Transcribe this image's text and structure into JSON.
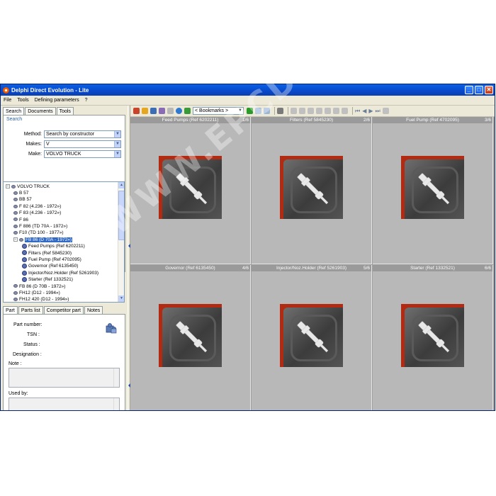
{
  "window": {
    "title": "Delphi Direct Evolution - Lite"
  },
  "menu": [
    "File",
    "Tools",
    "Defining parameters",
    "?"
  ],
  "left_tabs": [
    "Search",
    "Documents",
    "Tools"
  ],
  "search": {
    "heading": "Search",
    "method_label": "Method:",
    "method_value": "Search by constructor",
    "makes_label": "Makes:",
    "makes_value": "V",
    "make_label": "Make:",
    "make_value": "VOLVO TRUCK"
  },
  "tree": {
    "root": "VOLVO TRUCK",
    "items": [
      {
        "label": "B 57",
        "level": 1
      },
      {
        "label": "BB 57",
        "level": 1
      },
      {
        "label": "F 82 (4.236 - 1972»)",
        "level": 1
      },
      {
        "label": "F 83 (4.236 - 1972»)",
        "level": 1
      },
      {
        "label": "F 86",
        "level": 1
      },
      {
        "label": "F 886 (TD 70A - 1972»)",
        "level": 1
      },
      {
        "label": "F10 (TD 100 - 1977»)",
        "level": 1
      },
      {
        "label": "FB 86 (D 70A - 1972»)",
        "level": 1
      },
      {
        "label": "Feed Pumps (Ref 6202211)",
        "level": 2
      },
      {
        "label": "Filters (Ref 5845230)",
        "level": 2
      },
      {
        "label": "Fuel Pump (Ref 4702095)",
        "level": 2
      },
      {
        "label": "Governor (Ref 6135450)",
        "level": 2
      },
      {
        "label": "Injector/Noz.Holder (Ref 5261903)",
        "level": 2
      },
      {
        "label": "Starter (Ref 1332521)",
        "level": 2
      },
      {
        "label": "FB 86 (D 70B - 1972»)",
        "level": 1
      },
      {
        "label": "FH12 (D12 - 1994»)",
        "level": 1
      },
      {
        "label": "FH12 420 (D12 - 1994»)",
        "level": 1
      }
    ]
  },
  "bottom_tabs": [
    "Part",
    "Parts list",
    "Competitor part",
    "Notes"
  ],
  "part": {
    "part_number_label": "Part number:",
    "tsn_label": "TSN :",
    "status_label": "Status :",
    "designation_label": "Designation :",
    "note_label": "Note :",
    "used_by_label": "Used by:"
  },
  "toolbar": {
    "bookmarks": "< Bookmarks >"
  },
  "cells": [
    {
      "title": "Feed Pumps (Ref 6202211)",
      "index": "1/6"
    },
    {
      "title": "Filters (Ref 5845230)",
      "index": "2/6"
    },
    {
      "title": "Fuel Pump (Ref 4702095)",
      "index": "3/6"
    },
    {
      "title": "Governor (Ref 6135450)",
      "index": "4/6"
    },
    {
      "title": "Injector/Noz.Holder (Ref 5261903)",
      "index": "5/6"
    },
    {
      "title": "Starter (Ref 1332521)",
      "index": "6/6"
    }
  ],
  "watermark": "WWW.EPCDEPO.COM"
}
